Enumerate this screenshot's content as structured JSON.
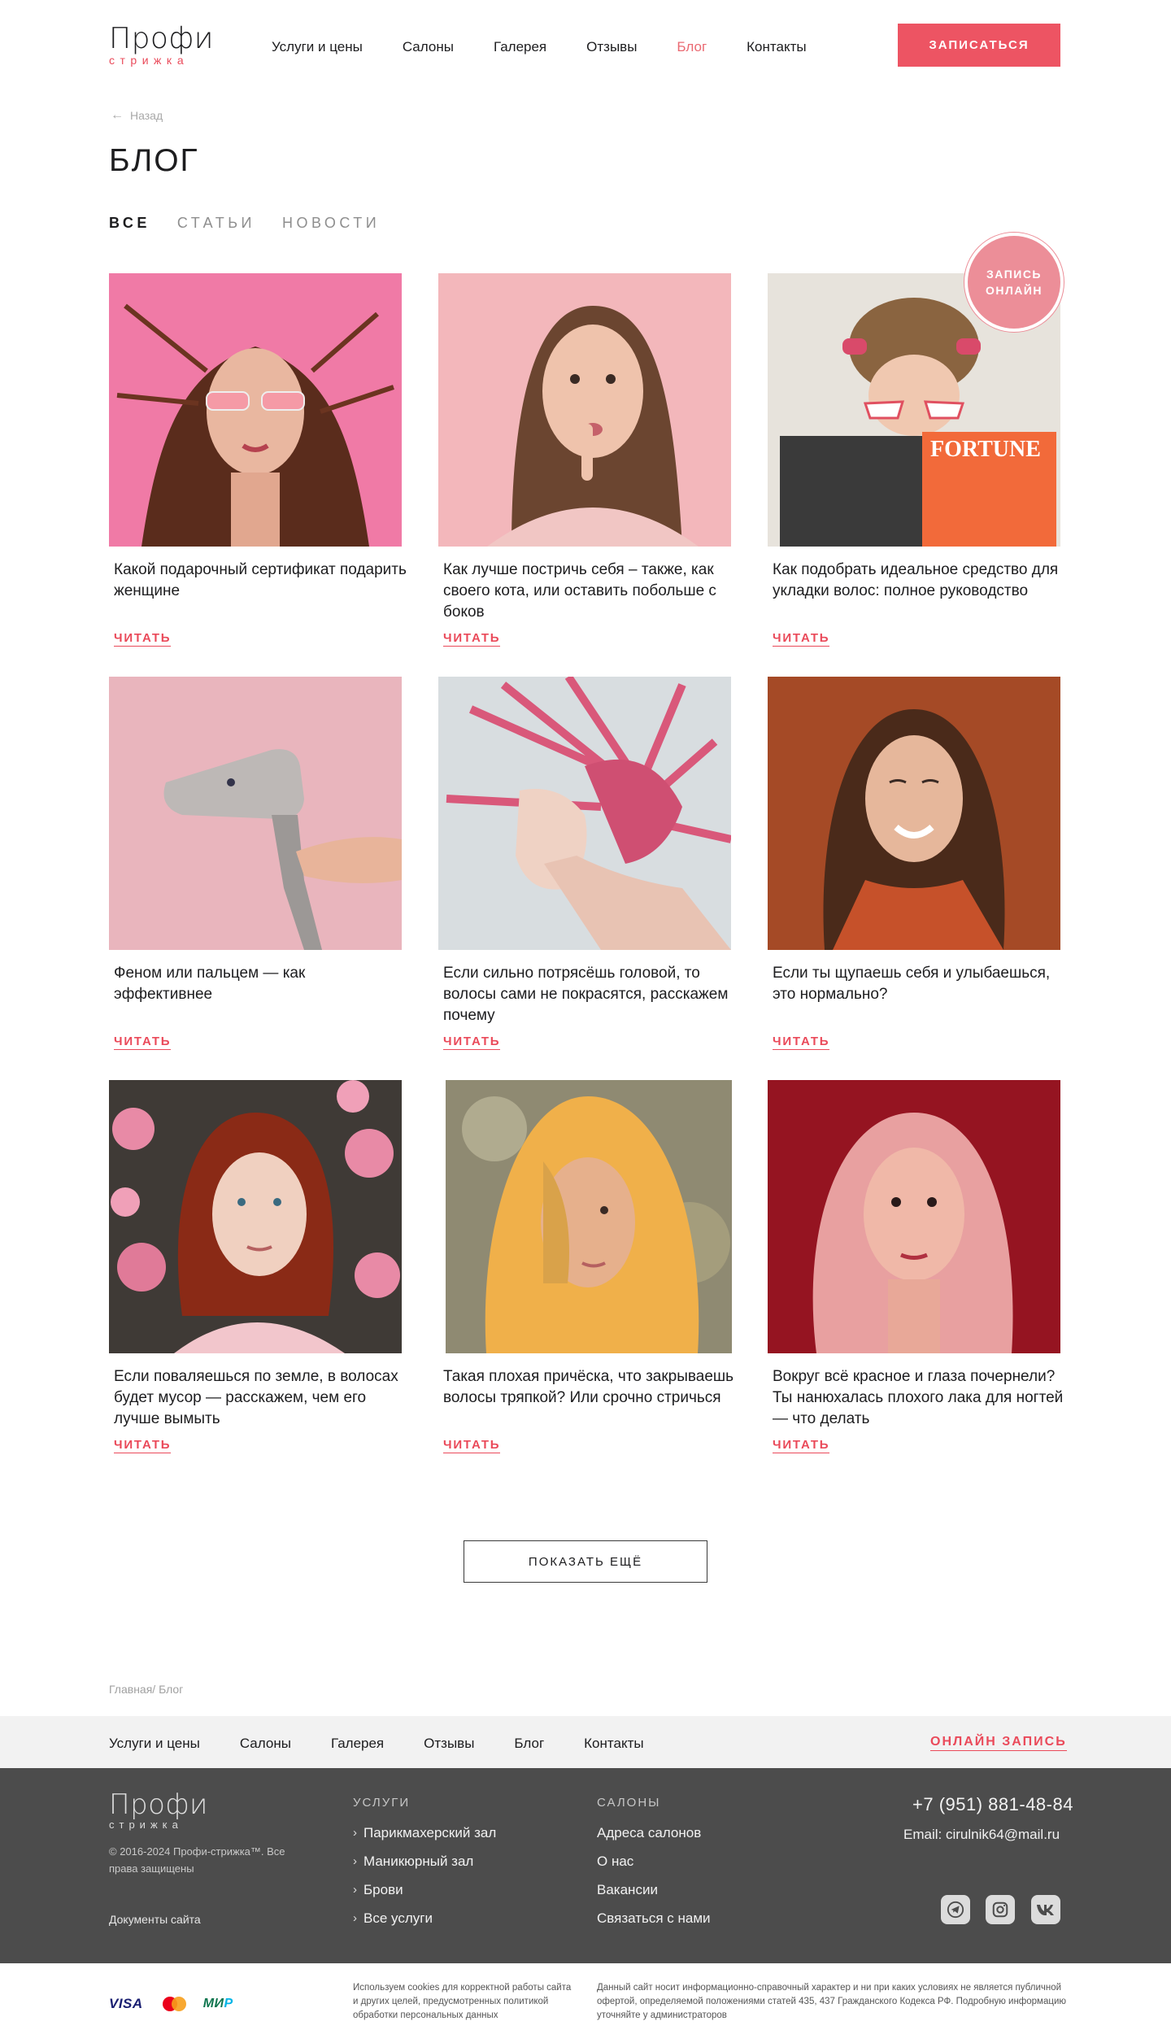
{
  "header": {
    "logo_main": "Профи",
    "logo_sub": "стрижка",
    "nav": [
      "Услуги и цены",
      "Салоны",
      "Галерея",
      "Отзывы",
      "Блог",
      "Контакты"
    ],
    "active_nav": "Блог",
    "book_button": "ЗАПИСАТЬСЯ"
  },
  "back_label": "Назад",
  "page_title": "БЛОГ",
  "filters": [
    "ВСЕ",
    "СТАТЬИ",
    "НОВОСТИ"
  ],
  "badge": {
    "line1": "ЗАПИСЬ",
    "line2": "ОНЛАЙН"
  },
  "read_label": "ЧИТАТЬ",
  "cards": [
    {
      "title": "Какой подарочный сертификат подарить женщине"
    },
    {
      "title": "Как лучше постричь себя – также, как своего кота, или оставить побольше с боков"
    },
    {
      "title": "Как подобрать идеальное средство для укладки волос: полное руководство"
    },
    {
      "title": "Феном или пальцем — как эффективнее"
    },
    {
      "title": "Если сильно потрясёшь головой, то волосы сами не покрасятся, расскажем почему"
    },
    {
      "title": "Если ты щупаешь себя и улыбаешься, это нормально?"
    },
    {
      "title": "Если поваляешься по земле, в волосах будет мусор — расскажем, чем его лучше вымыть"
    },
    {
      "title": "Такая плохая причёска, что закрываешь волосы тряпкой? Или срочно стричься"
    },
    {
      "title": "Вокруг всё красное и глаза почернели? Ты нанюхалась плохого лака для ногтей — что делать"
    }
  ],
  "show_more": "ПОКАЗАТЬ ЕЩЁ",
  "breadcrumbs": "Главная/ Блог",
  "footer_nav": {
    "links": [
      "Услуги и цены",
      "Салоны",
      "Галерея",
      "Отзывы",
      "Блог",
      "Контакты"
    ],
    "online": "ОНЛАЙН ЗАПИСЬ"
  },
  "footer": {
    "logo_main": "Профи",
    "logo_sub": "стрижка",
    "copyright": "© 2016-2024 Профи-стрижка™. Все права защищены",
    "docs": "Документы сайта",
    "services_head": "УСЛУГИ",
    "services": [
      "Парикмахерский зал",
      "Маникюрный зал",
      "Брови",
      "Все услуги"
    ],
    "salons_head": "САЛОНЫ",
    "salons": [
      "Адреса салонов",
      "О нас",
      "Вакансии",
      "Связаться с нами"
    ],
    "phone": "+7 (951) 881-48-84",
    "email": "Email: cirulnik64@mail.ru",
    "social_icons": [
      "telegram-icon",
      "instagram-icon",
      "vk-icon"
    ]
  },
  "bottom": {
    "visa": "VISA",
    "mir_1": "МИ",
    "mir_2": "Р",
    "cookies": "Используем cookies для корректной работы сайта и других целей, предусмотренных политикой обработки персональных данных",
    "legal": "Данный сайт носит информационно-справочный характер и ни при каких условиях не является публичной офертой, определяемой положениями статей 435, 437 Гражданского Кодекса РФ. Подробную информацию уточняйте у администраторов"
  },
  "colors": {
    "accent": "#ed5463",
    "footer_bg": "#4c4c4c",
    "footer_nav_bg": "#f2f2f2"
  }
}
